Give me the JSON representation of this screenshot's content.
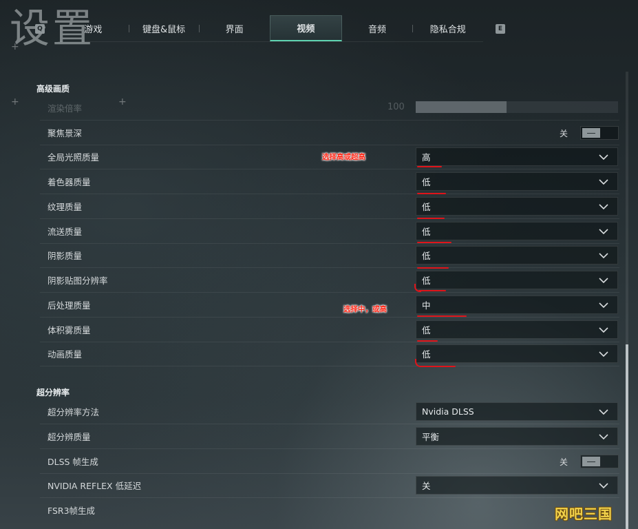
{
  "page": {
    "title": "设置"
  },
  "key_hints": {
    "left": "Q",
    "right": "E"
  },
  "tabs": [
    {
      "label": "游戏",
      "active": false
    },
    {
      "label": "键盘&鼠标",
      "active": false
    },
    {
      "label": "界面",
      "active": false
    },
    {
      "label": "视频",
      "active": true
    },
    {
      "label": "音频",
      "active": false
    },
    {
      "label": "隐私合规",
      "active": false
    }
  ],
  "sections": {
    "advanced": {
      "title": "高级画质",
      "render_scale": {
        "label": "渲染倍率",
        "value": "100",
        "fill_percent": 45
      },
      "dof": {
        "label": "聚焦景深",
        "state": "关"
      },
      "gi": {
        "label": "全局光照质量",
        "value": "高"
      },
      "shader": {
        "label": "着色器质量",
        "value": "低"
      },
      "texture": {
        "label": "纹理质量",
        "value": "低"
      },
      "streaming": {
        "label": "流送质量",
        "value": "低"
      },
      "shadow": {
        "label": "阴影质量",
        "value": "低"
      },
      "shadowmap": {
        "label": "阴影贴图分辨率",
        "value": "低"
      },
      "postprocess": {
        "label": "后处理质量",
        "value": "中"
      },
      "fog": {
        "label": "体积雾质量",
        "value": "低"
      },
      "animation": {
        "label": "动画质量",
        "value": "低"
      }
    },
    "upscale": {
      "title": "超分辨率",
      "method": {
        "label": "超分辨率方法",
        "value": "Nvidia DLSS"
      },
      "quality": {
        "label": "超分辨质量",
        "value": "平衡"
      },
      "framegen": {
        "label": "DLSS 帧生成",
        "state": "关"
      },
      "reflex": {
        "label": "NVIDIA REFLEX 低延迟",
        "value": "关"
      },
      "fsr3": {
        "label": "FSR3帧生成"
      }
    }
  },
  "annotations": {
    "gi_note": "选择高或超高",
    "post_note": "选择中，或高"
  },
  "watermark": "网吧三国",
  "colors": {
    "accent": "#5fd3b0",
    "annotation": "#e0141a"
  }
}
